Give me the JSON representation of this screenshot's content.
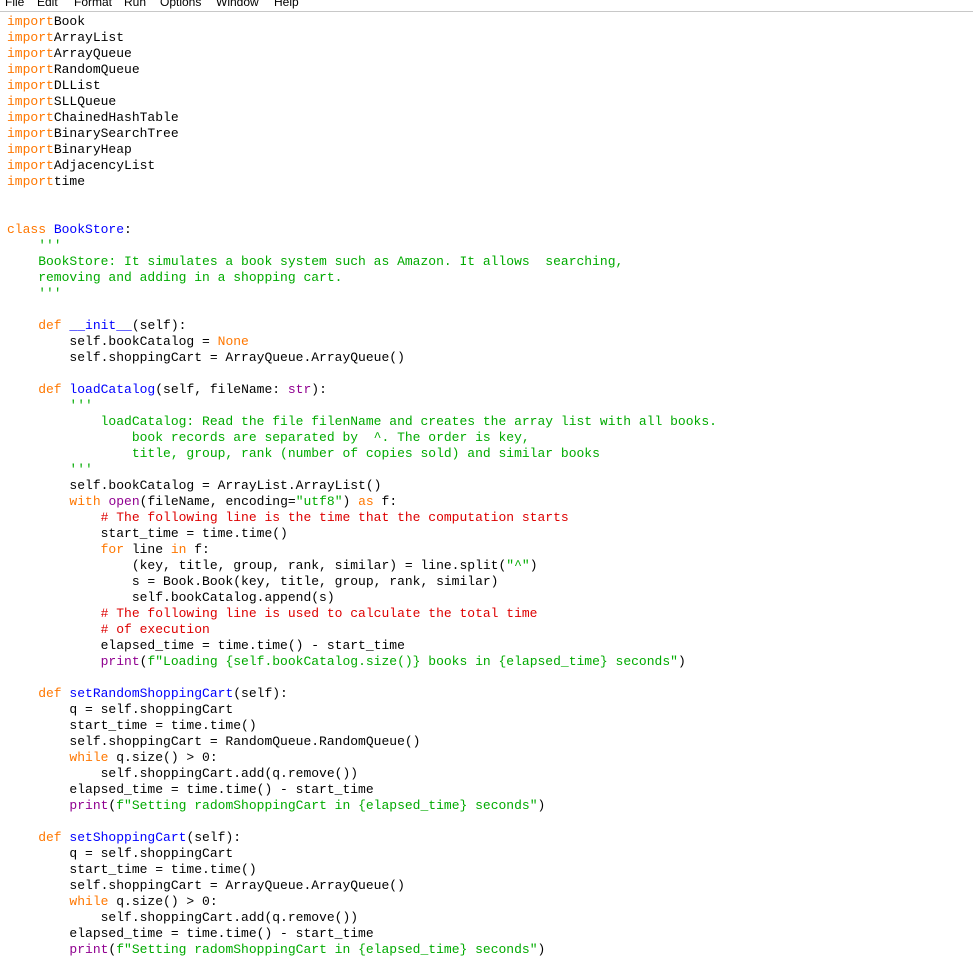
{
  "menu": [
    "File",
    "Edit",
    "Format",
    "Run",
    "Options",
    "Window",
    "Help"
  ],
  "colors": {
    "keyword": "#ff7700",
    "builtin": "#900090",
    "definition": "#0000ff",
    "string": "#00aa00",
    "comment": "#dd0000"
  },
  "code": [
    [
      [
        "kw",
        "import"
      ],
      [
        "",
        "Book"
      ]
    ],
    [
      [
        "kw",
        "import"
      ],
      [
        "",
        "ArrayList"
      ]
    ],
    [
      [
        "kw",
        "import"
      ],
      [
        "",
        "ArrayQueue"
      ]
    ],
    [
      [
        "kw",
        "import"
      ],
      [
        "",
        "RandomQueue"
      ]
    ],
    [
      [
        "kw",
        "import"
      ],
      [
        "",
        "DLList"
      ]
    ],
    [
      [
        "kw",
        "import"
      ],
      [
        "",
        "SLLQueue"
      ]
    ],
    [
      [
        "kw",
        "import"
      ],
      [
        "",
        "ChainedHashTable"
      ]
    ],
    [
      [
        "kw",
        "import"
      ],
      [
        "",
        "BinarySearchTree"
      ]
    ],
    [
      [
        "kw",
        "import"
      ],
      [
        "",
        "BinaryHeap"
      ]
    ],
    [
      [
        "kw",
        "import"
      ],
      [
        "",
        "AdjacencyList"
      ]
    ],
    [
      [
        "kw",
        "import"
      ],
      [
        "",
        "time"
      ]
    ],
    [],
    [],
    [
      [
        "kw",
        "class"
      ],
      [
        "",
        " "
      ],
      [
        "def",
        "BookStore"
      ],
      [
        "",
        ":"
      ]
    ],
    [
      [
        "str",
        "    '''"
      ]
    ],
    [
      [
        "str",
        "    BookStore: It simulates a book system such as Amazon. It allows  searching,"
      ]
    ],
    [
      [
        "str",
        "    removing and adding in a shopping cart."
      ]
    ],
    [
      [
        "str",
        "    '''"
      ]
    ],
    [],
    [
      [
        "kw",
        "    def"
      ],
      [
        "",
        " "
      ],
      [
        "def",
        "__init__"
      ],
      [
        "",
        "(self):"
      ]
    ],
    [
      [
        "",
        "        self.bookCatalog = "
      ],
      [
        "kw",
        "None"
      ]
    ],
    [
      [
        "",
        "        self.shoppingCart = ArrayQueue.ArrayQueue()"
      ]
    ],
    [],
    [
      [
        "kw",
        "    def"
      ],
      [
        "",
        " "
      ],
      [
        "def",
        "loadCatalog"
      ],
      [
        "",
        "(self, fileName: "
      ],
      [
        "bi",
        "str"
      ],
      [
        "",
        "):"
      ]
    ],
    [
      [
        "str",
        "        '''"
      ]
    ],
    [
      [
        "str",
        "            loadCatalog: Read the file filenName and creates the array list with all books."
      ]
    ],
    [
      [
        "str",
        "                book records are separated by  ^. The order is key,"
      ]
    ],
    [
      [
        "str",
        "                title, group, rank (number of copies sold) and similar books"
      ]
    ],
    [
      [
        "str",
        "        '''"
      ]
    ],
    [
      [
        "",
        "        self.bookCatalog = ArrayList.ArrayList()"
      ]
    ],
    [
      [
        "kw",
        "        with"
      ],
      [
        "",
        " "
      ],
      [
        "bi",
        "open"
      ],
      [
        "",
        "(fileName, encoding="
      ],
      [
        "str",
        "\"utf8\""
      ],
      [
        "",
        ") "
      ],
      [
        "kw",
        "as"
      ],
      [
        "",
        " f:"
      ]
    ],
    [
      [
        "com",
        "            # The following line is the time that the computation starts"
      ]
    ],
    [
      [
        "",
        "            start_time = time.time()"
      ]
    ],
    [
      [
        "kw",
        "            for"
      ],
      [
        "",
        " line "
      ],
      [
        "kw",
        "in"
      ],
      [
        "",
        " f:"
      ]
    ],
    [
      [
        "",
        "                (key, title, group, rank, similar) = line.split("
      ],
      [
        "str",
        "\"^\""
      ],
      [
        "",
        ")"
      ]
    ],
    [
      [
        "",
        "                s = Book.Book(key, title, group, rank, similar)"
      ]
    ],
    [
      [
        "",
        "                self.bookCatalog.append(s)"
      ]
    ],
    [
      [
        "com",
        "            # The following line is used to calculate the total time"
      ]
    ],
    [
      [
        "com",
        "            # of execution"
      ]
    ],
    [
      [
        "",
        "            elapsed_time = time.time() - start_time"
      ]
    ],
    [
      [
        "bi",
        "            print"
      ],
      [
        "",
        "("
      ],
      [
        "str",
        "f\"Loading {self.bookCatalog.size()} books in {elapsed_time} seconds\""
      ],
      [
        "",
        ")"
      ]
    ],
    [],
    [
      [
        "kw",
        "    def"
      ],
      [
        "",
        " "
      ],
      [
        "def",
        "setRandomShoppingCart"
      ],
      [
        "",
        "(self):"
      ]
    ],
    [
      [
        "",
        "        q = self.shoppingCart"
      ]
    ],
    [
      [
        "",
        "        start_time = time.time()"
      ]
    ],
    [
      [
        "",
        "        self.shoppingCart = RandomQueue.RandomQueue()"
      ]
    ],
    [
      [
        "kw",
        "        while"
      ],
      [
        "",
        " q.size() > 0:"
      ]
    ],
    [
      [
        "",
        "            self.shoppingCart.add(q.remove())"
      ]
    ],
    [
      [
        "",
        "        elapsed_time = time.time() - start_time"
      ]
    ],
    [
      [
        "bi",
        "        print"
      ],
      [
        "",
        "("
      ],
      [
        "str",
        "f\"Setting radomShoppingCart in {elapsed_time} seconds\""
      ],
      [
        "",
        ")"
      ]
    ],
    [],
    [
      [
        "kw",
        "    def"
      ],
      [
        "",
        " "
      ],
      [
        "def",
        "setShoppingCart"
      ],
      [
        "",
        "(self):"
      ]
    ],
    [
      [
        "",
        "        q = self.shoppingCart"
      ]
    ],
    [
      [
        "",
        "        start_time = time.time()"
      ]
    ],
    [
      [
        "",
        "        self.shoppingCart = ArrayQueue.ArrayQueue()"
      ]
    ],
    [
      [
        "kw",
        "        while"
      ],
      [
        "",
        " q.size() > 0:"
      ]
    ],
    [
      [
        "",
        "            self.shoppingCart.add(q.remove())"
      ]
    ],
    [
      [
        "",
        "        elapsed_time = time.time() - start_time"
      ]
    ],
    [
      [
        "bi",
        "        print"
      ],
      [
        "",
        "("
      ],
      [
        "str",
        "f\"Setting radomShoppingCart in {elapsed_time} seconds\""
      ],
      [
        "",
        ")"
      ]
    ]
  ]
}
